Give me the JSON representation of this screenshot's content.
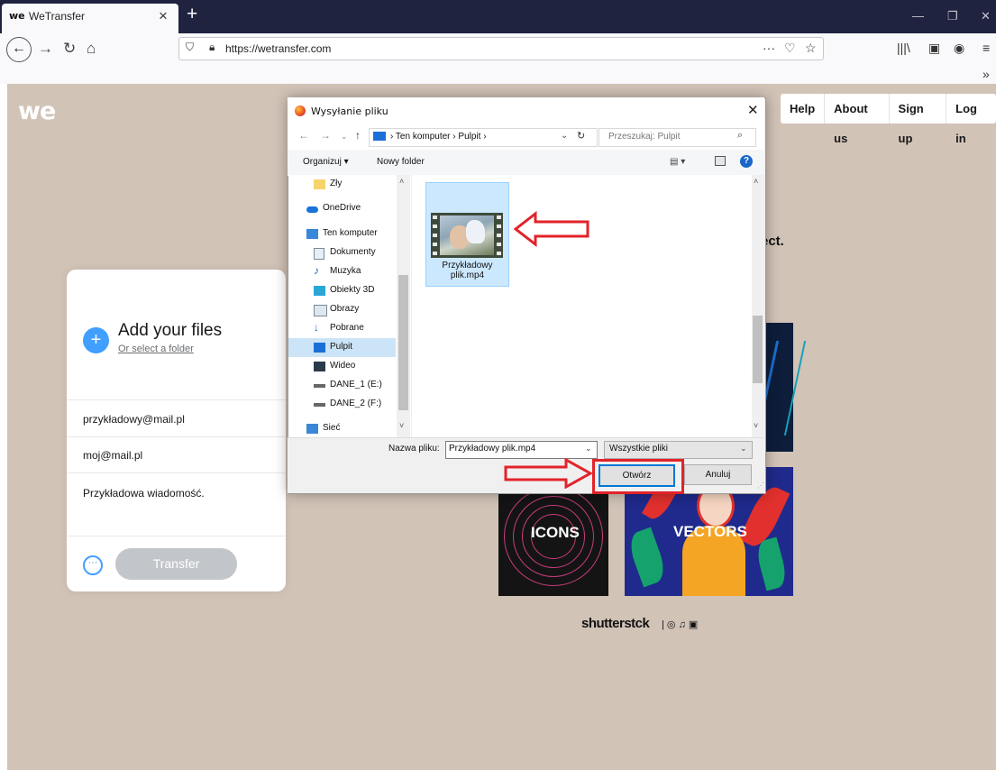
{
  "browser": {
    "tab_logo": "we",
    "tab_title": "WeTransfer",
    "url": "https://wetransfer.com"
  },
  "site": {
    "logo": "we",
    "nav": [
      "Help",
      "About us",
      "Sign up",
      "Log in"
    ],
    "ad_text_fragment": "ect."
  },
  "upload_panel": {
    "add_title": "Add your files",
    "select_folder": "Or select a folder",
    "email_to": "przykładowy@mail.pl",
    "email_from": "moj@mail.pl",
    "message": "Przykładowa wiadomość.",
    "transfer_label": "Transfer"
  },
  "ads": {
    "icons_label": "ICONS",
    "vectors_label": "VECTORS",
    "brand": "shutterstck",
    "brand_icons": "| ◎ ♫ ▣"
  },
  "dialog": {
    "title": "Wysyłanie pliku",
    "path": "›  Ten komputer  ›  Pulpit  ›",
    "search_placeholder": "Przeszukaj: Pulpit",
    "organize": "Organizuj ▾",
    "new_folder": "Nowy folder",
    "nav_items": [
      {
        "label": "Zły",
        "icon": "folder-icon"
      },
      {
        "label": "OneDrive",
        "icon": "cloud-icon"
      },
      {
        "label": "Ten komputer",
        "icon": "computer-icon"
      },
      {
        "label": "Dokumenty",
        "icon": "documents-icon"
      },
      {
        "label": "Muzyka",
        "icon": "music-icon"
      },
      {
        "label": "Obiekty 3D",
        "icon": "cube-icon"
      },
      {
        "label": "Obrazy",
        "icon": "pictures-icon"
      },
      {
        "label": "Pobrane",
        "icon": "download-icon"
      },
      {
        "label": "Pulpit",
        "icon": "desktop-icon"
      },
      {
        "label": "Wideo",
        "icon": "video-icon"
      },
      {
        "label": "DANE_1 (E:)",
        "icon": "drive-icon"
      },
      {
        "label": "DANE_2 (F:)",
        "icon": "drive-icon"
      },
      {
        "label": "Sieć",
        "icon": "network-icon"
      }
    ],
    "selected_nav": "Pulpit",
    "file_name_line1": "Przykładowy",
    "file_name_line2": "plik.mp4",
    "filename_label": "Nazwa pliku:",
    "filename_value": "Przykładowy plik.mp4",
    "filter_value": "Wszystkie pliki",
    "open_label": "Otwórz",
    "cancel_label": "Anuluj"
  },
  "colors": {
    "page_bg": "#d2c3b7",
    "accent": "#409fff",
    "annotation_red": "#e2232a",
    "selection": "#cce8ff"
  }
}
